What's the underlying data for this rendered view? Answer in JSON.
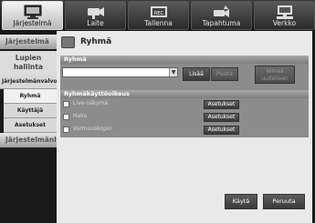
{
  "topnav": [
    {
      "label": "Järjestelmä",
      "icon": "monitor-icon",
      "active": true
    },
    {
      "label": "Laite",
      "icon": "camera-icon",
      "active": false
    },
    {
      "label": "Tallenna",
      "icon": "rec-icon",
      "active": false
    },
    {
      "label": "Tapahtuma",
      "icon": "event-camera-icon",
      "active": false
    },
    {
      "label": "Verkko",
      "icon": "network-icon",
      "active": false
    }
  ],
  "sidebar": {
    "section1": "Järjestelmä",
    "section1_sub": "Lupien hallinta",
    "items": [
      "Järjestelmänvalvoja",
      "Ryhmä",
      "Käyttäjä",
      "Asetukset"
    ],
    "section2": "Järjestelmänh"
  },
  "main": {
    "title": "Ryhmä",
    "group_section": {
      "header": "Ryhmä",
      "combo_value": "",
      "add_label": "Lisää",
      "delete_label": "Poista",
      "rename_label": "Nimeä uudelleen"
    },
    "perm_section": {
      "header": "Ryhmäkäyttöoikeus",
      "rows": [
        {
          "label": "Live-näkymä",
          "button": "Asetukset"
        },
        {
          "label": "Haku",
          "button": "Asetukset"
        },
        {
          "label": "Varmuuskopio",
          "button": "Asetukset"
        }
      ]
    },
    "apply_label": "Käytä",
    "cancel_label": "Peruuta"
  }
}
